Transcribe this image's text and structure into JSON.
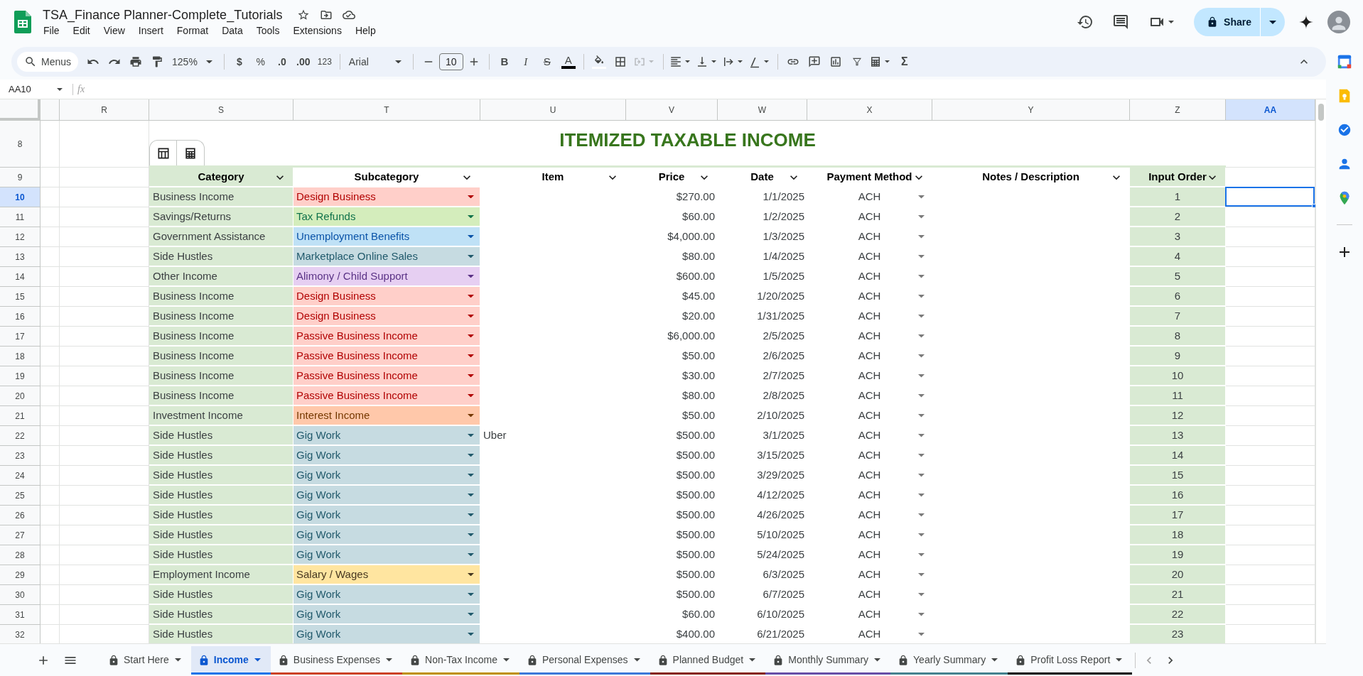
{
  "document": {
    "title": "TSA_Finance Planner-Complete_Tutorials",
    "menu": [
      "File",
      "Edit",
      "View",
      "Insert",
      "Format",
      "Data",
      "Tools",
      "Extensions",
      "Help"
    ]
  },
  "share_button": "Share",
  "toolbar": {
    "search": "Menus",
    "zoom": "125%",
    "currency": "$",
    "percent": "%",
    "decimal_decrease": ".0",
    "decimal_increase": ".00",
    "number_format": "123",
    "font": "Arial",
    "font_size": "10",
    "bold": "B",
    "italic": "I",
    "strikethrough": "S",
    "text_color": "A",
    "functions": "Σ"
  },
  "formula_bar": {
    "name_box": "AA10",
    "fx": "fx"
  },
  "columns": [
    {
      "label": "R",
      "selected": false
    },
    {
      "label": "S",
      "selected": false
    },
    {
      "label": "T",
      "selected": false
    },
    {
      "label": "U",
      "selected": false
    },
    {
      "label": "V",
      "selected": false
    },
    {
      "label": "W",
      "selected": false
    },
    {
      "label": "X",
      "selected": false
    },
    {
      "label": "Y",
      "selected": false
    },
    {
      "label": "Z",
      "selected": false
    },
    {
      "label": "AA",
      "selected": true
    }
  ],
  "row_headers": [
    {
      "label": "8",
      "selected": false
    },
    {
      "label": "9",
      "selected": false
    },
    {
      "label": "10",
      "selected": true
    },
    {
      "label": "11",
      "selected": false
    },
    {
      "label": "12",
      "selected": false
    },
    {
      "label": "13",
      "selected": false
    },
    {
      "label": "14",
      "selected": false
    },
    {
      "label": "15",
      "selected": false
    },
    {
      "label": "16",
      "selected": false
    },
    {
      "label": "17",
      "selected": false
    },
    {
      "label": "18",
      "selected": false
    },
    {
      "label": "19",
      "selected": false
    },
    {
      "label": "20",
      "selected": false
    },
    {
      "label": "21",
      "selected": false
    },
    {
      "label": "22",
      "selected": false
    },
    {
      "label": "23",
      "selected": false
    },
    {
      "label": "24",
      "selected": false
    },
    {
      "label": "25",
      "selected": false
    },
    {
      "label": "26",
      "selected": false
    },
    {
      "label": "27",
      "selected": false
    },
    {
      "label": "28",
      "selected": false
    },
    {
      "label": "29",
      "selected": false
    },
    {
      "label": "30",
      "selected": false
    },
    {
      "label": "31",
      "selected": false
    },
    {
      "label": "32",
      "selected": false
    }
  ],
  "table": {
    "title": "ITEMIZED TAXABLE INCOME",
    "columns": [
      "Category",
      "Subcategory",
      "Item",
      "Price",
      "Date",
      "Payment Method",
      "Notes / Description",
      "Input Order"
    ],
    "rows": [
      {
        "category": "Business Income",
        "subcategory": "Design Business",
        "color": "#ffcfc9",
        "price": "$270.00",
        "date": "1/1/2025",
        "payment": "ACH",
        "order": "1"
      },
      {
        "category": "Savings/Returns",
        "subcategory": "Tax Refunds",
        "color": "#d4edbc",
        "price": "$60.00",
        "date": "1/2/2025",
        "payment": "ACH",
        "order": "2"
      },
      {
        "category": "Government Assistance",
        "subcategory": "Unemployment Benefits",
        "color": "#bfe1f6",
        "price": "$4,000.00",
        "date": "1/3/2025",
        "payment": "ACH",
        "order": "3"
      },
      {
        "category": "Side Hustles",
        "subcategory": "Marketplace Online Sales",
        "color": "#c6dbe1",
        "price": "$80.00",
        "date": "1/4/2025",
        "payment": "ACH",
        "order": "4"
      },
      {
        "category": "Other Income",
        "subcategory": "Alimony / Child Support",
        "color": "#e6cff2",
        "price": "$600.00",
        "date": "1/5/2025",
        "payment": "ACH",
        "order": "5"
      },
      {
        "category": "Business Income",
        "subcategory": "Design Business",
        "color": "#ffcfc9",
        "price": "$45.00",
        "date": "1/20/2025",
        "payment": "ACH",
        "order": "6"
      },
      {
        "category": "Business Income",
        "subcategory": "Design Business",
        "color": "#ffcfc9",
        "price": "$20.00",
        "date": "1/31/2025",
        "payment": "ACH",
        "order": "7"
      },
      {
        "category": "Business Income",
        "subcategory": "Passive Business Income",
        "color": "#ffcfc9",
        "price": "$6,000.00",
        "date": "2/5/2025",
        "payment": "ACH",
        "order": "8"
      },
      {
        "category": "Business Income",
        "subcategory": "Passive Business Income",
        "color": "#ffcfc9",
        "price": "$50.00",
        "date": "2/6/2025",
        "payment": "ACH",
        "order": "9"
      },
      {
        "category": "Business Income",
        "subcategory": "Passive Business Income",
        "color": "#ffcfc9",
        "price": "$30.00",
        "date": "2/7/2025",
        "payment": "ACH",
        "order": "10"
      },
      {
        "category": "Business Income",
        "subcategory": "Passive Business Income",
        "color": "#ffcfc9",
        "price": "$80.00",
        "date": "2/8/2025",
        "payment": "ACH",
        "order": "11"
      },
      {
        "category": "Investment Income",
        "subcategory": "Interest Income",
        "color": "#ffc8aa",
        "price": "$50.00",
        "date": "2/10/2025",
        "payment": "ACH",
        "order": "12"
      },
      {
        "category": "Side Hustles",
        "subcategory": "Gig Work",
        "color": "#c6dbe1",
        "item": "Uber",
        "price": "$500.00",
        "date": "3/1/2025",
        "payment": "ACH",
        "order": "13"
      },
      {
        "category": "Side Hustles",
        "subcategory": "Gig Work",
        "color": "#c6dbe1",
        "price": "$500.00",
        "date": "3/15/2025",
        "payment": "ACH",
        "order": "14"
      },
      {
        "category": "Side Hustles",
        "subcategory": "Gig Work",
        "color": "#c6dbe1",
        "price": "$500.00",
        "date": "3/29/2025",
        "payment": "ACH",
        "order": "15"
      },
      {
        "category": "Side Hustles",
        "subcategory": "Gig Work",
        "color": "#c6dbe1",
        "price": "$500.00",
        "date": "4/12/2025",
        "payment": "ACH",
        "order": "16"
      },
      {
        "category": "Side Hustles",
        "subcategory": "Gig Work",
        "color": "#c6dbe1",
        "price": "$500.00",
        "date": "4/26/2025",
        "payment": "ACH",
        "order": "17"
      },
      {
        "category": "Side Hustles",
        "subcategory": "Gig Work",
        "color": "#c6dbe1",
        "price": "$500.00",
        "date": "5/10/2025",
        "payment": "ACH",
        "order": "18"
      },
      {
        "category": "Side Hustles",
        "subcategory": "Gig Work",
        "color": "#c6dbe1",
        "price": "$500.00",
        "date": "5/24/2025",
        "payment": "ACH",
        "order": "19"
      },
      {
        "category": "Employment Income",
        "subcategory": "Salary / Wages",
        "color": "#ffe5a0",
        "price": "$500.00",
        "date": "6/3/2025",
        "payment": "ACH",
        "order": "20"
      },
      {
        "category": "Side Hustles",
        "subcategory": "Gig Work",
        "color": "#c6dbe1",
        "price": "$500.00",
        "date": "6/7/2025",
        "payment": "ACH",
        "order": "21"
      },
      {
        "category": "Side Hustles",
        "subcategory": "Gig Work",
        "color": "#c6dbe1",
        "price": "$60.00",
        "date": "6/10/2025",
        "payment": "ACH",
        "order": "22"
      },
      {
        "category": "Side Hustles",
        "subcategory": "Gig Work",
        "color": "#c6dbe1",
        "price": "$400.00",
        "date": "6/21/2025",
        "payment": "ACH",
        "order": "23"
      }
    ]
  },
  "sheet_tabs": [
    {
      "label": "Start Here",
      "selected": false
    },
    {
      "label": "Income",
      "selected": true,
      "color": "#1a73e8"
    },
    {
      "label": "Business Expenses",
      "selected": false,
      "color": "#cc4125"
    },
    {
      "label": "Non-Tax Income",
      "selected": false,
      "color": "#bf9000"
    },
    {
      "label": "Personal Expenses",
      "selected": false,
      "color": "#3c78d8"
    },
    {
      "label": "Planned Budget",
      "selected": false,
      "color": "#85200c"
    },
    {
      "label": "Monthly Summary",
      "selected": false,
      "color": "#674ea7"
    },
    {
      "label": "Yearly Summary",
      "selected": false,
      "color": "#45818e"
    },
    {
      "label": "Profit Loss Report",
      "selected": false,
      "color": "#000000"
    }
  ]
}
